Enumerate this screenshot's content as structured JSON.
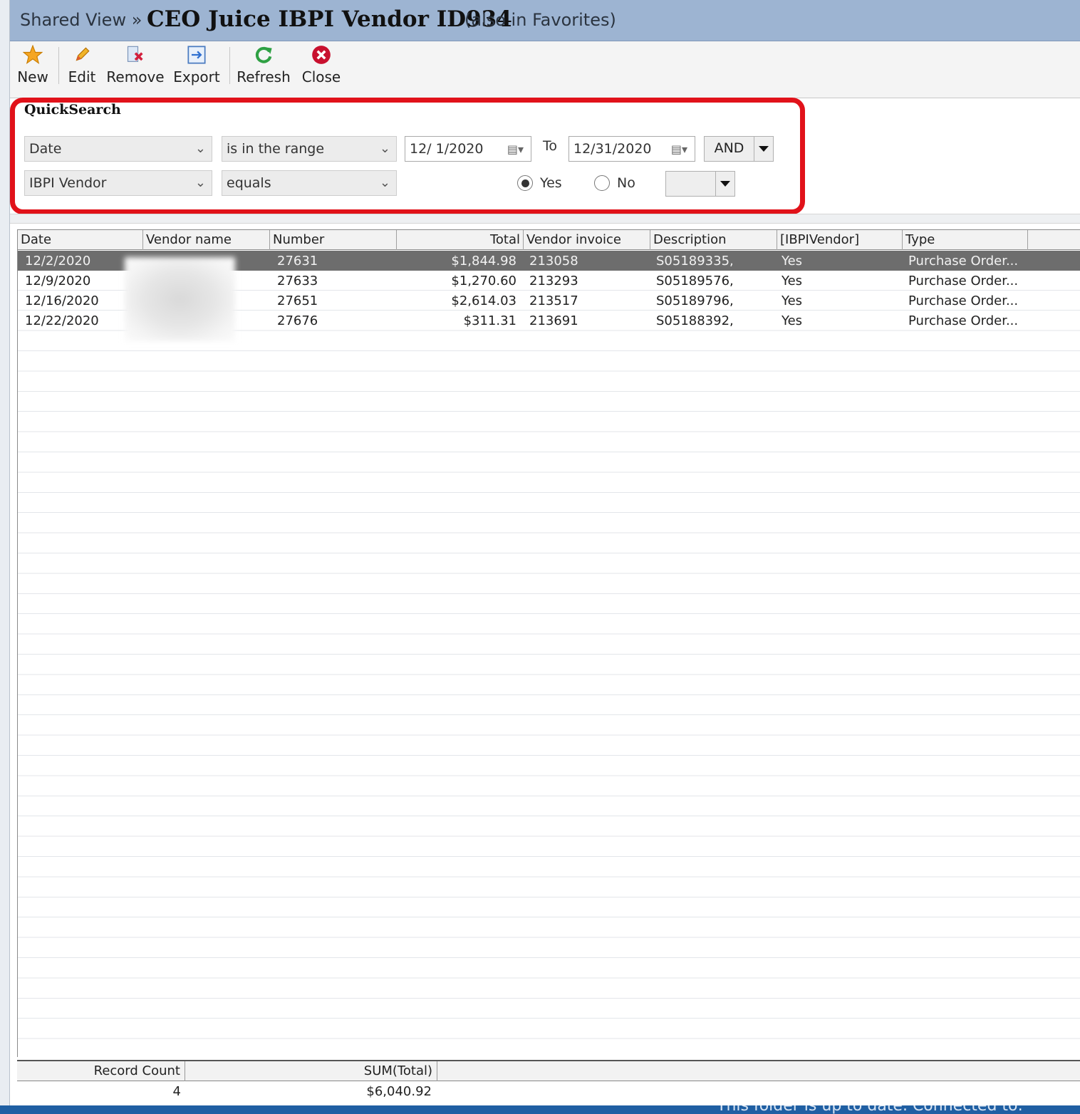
{
  "header": {
    "breadcrumb": "Shared View »",
    "title": "CEO Juice IBPI Vendor ID934",
    "favorites_note": "(also in Favorites)"
  },
  "toolbar": {
    "new": "New",
    "edit": "Edit",
    "remove": "Remove",
    "export": "Export",
    "refresh": "Refresh",
    "close": "Close"
  },
  "quicksearch": {
    "title": "QuickSearch",
    "row1": {
      "field": "Date",
      "operator": "is in the range",
      "from": "12/ 1/2020",
      "to_label": "To",
      "to": "12/31/2020",
      "conjunction": "AND"
    },
    "row2": {
      "field": "IBPI Vendor",
      "operator": "equals",
      "yes_label": "Yes",
      "no_label": "No",
      "selected": "Yes"
    }
  },
  "grid": {
    "columns": [
      "Date",
      "Vendor name",
      "Number",
      "Total",
      "Vendor invoice",
      "Description",
      "[IBPIVendor]",
      "Type"
    ],
    "rows": [
      {
        "date": "12/2/2020",
        "number": "27631",
        "total": "$1,844.98",
        "invoice": "213058",
        "description": "S05189335,",
        "ibpi": "Yes",
        "type": "Purchase Order..."
      },
      {
        "date": "12/9/2020",
        "number": "27633",
        "total": "$1,270.60",
        "invoice": "213293",
        "description": "S05189576,",
        "ibpi": "Yes",
        "type": "Purchase Order..."
      },
      {
        "date": "12/16/2020",
        "number": "27651",
        "total": "$2,614.03",
        "invoice": "213517",
        "description": "S05189796,",
        "ibpi": "Yes",
        "type": "Purchase Order..."
      },
      {
        "date": "12/22/2020",
        "number": "27676",
        "total": "$311.31",
        "invoice": "213691",
        "description": "S05188392,",
        "ibpi": "Yes",
        "type": "Purchase Order..."
      }
    ]
  },
  "summary": {
    "record_count_label": "Record Count",
    "record_count": "4",
    "sum_label": "SUM(Total)",
    "sum_value": "$6,040.92"
  },
  "status": {
    "text": "This folder is up to date.     Connected to:"
  }
}
